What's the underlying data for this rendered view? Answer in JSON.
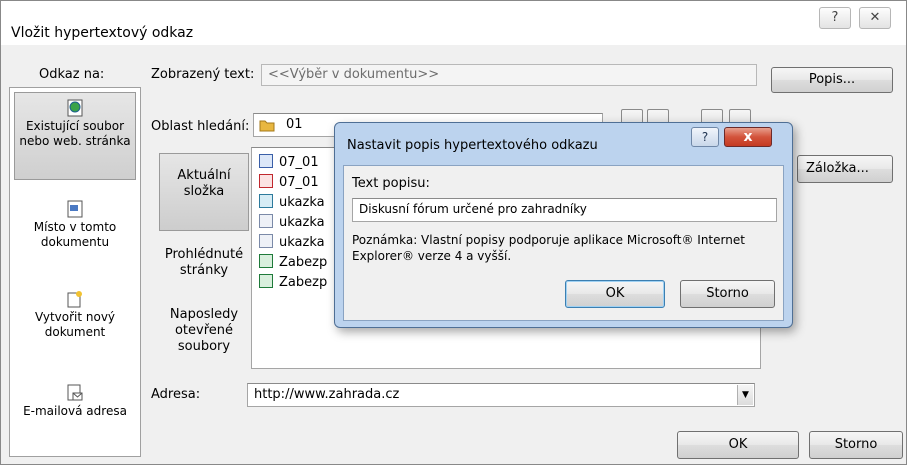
{
  "dialog": {
    "title": "Vložit hypertextový odkaz",
    "help_glyph": "?",
    "close_glyph": "✕"
  },
  "link_to": {
    "label": "Odkaz na:",
    "items": [
      {
        "label": "Existující soubor nebo web. stránka",
        "icon": "globe-file-icon",
        "selected": true
      },
      {
        "label": "Místo v tomto dokumentu",
        "icon": "document-place-icon",
        "selected": false
      },
      {
        "label": "Vytvořit nový dokument",
        "icon": "new-document-icon",
        "selected": false
      },
      {
        "label": "E-mailová adresa",
        "icon": "email-icon",
        "selected": false
      }
    ]
  },
  "display_text": {
    "label": "Zobrazený text:",
    "value": "<<Výběr v dokumentu>>",
    "button": "Popis..."
  },
  "search_in": {
    "label": "Oblast hledání:",
    "value": "01"
  },
  "bookmark_button": "Záložka...",
  "side_tabs": [
    {
      "label": "Aktuální složka",
      "selected": true
    },
    {
      "label": "Prohlédnuté stránky",
      "selected": false
    },
    {
      "label": "Naposledy otevřené soubory",
      "selected": false
    }
  ],
  "files": [
    {
      "name": "07_01",
      "type": "word"
    },
    {
      "name": "07_01",
      "type": "pdf"
    },
    {
      "name": "ukazka",
      "type": "img"
    },
    {
      "name": "ukazka",
      "type": "doc"
    },
    {
      "name": "ukazka",
      "type": "doc"
    },
    {
      "name": "Zabezp",
      "type": "xls"
    },
    {
      "name": "Zabezp",
      "type": "xls"
    }
  ],
  "address": {
    "label": "Adresa:",
    "value": "http://www.zahrada.cz"
  },
  "buttons": {
    "ok": "OK",
    "cancel": "Storno"
  },
  "popup": {
    "title": "Nastavit popis hypertextového odkazu",
    "help_glyph": "?",
    "close_glyph": "x",
    "field_label": "Text popisu:",
    "field_value": "Diskusní fórum určené pro zahradníky",
    "note": "Poznámka: Vlastní popisy podporuje aplikace Microsoft® Internet Explorer® verze 4 a vyšší.",
    "ok": "OK",
    "cancel": "Storno"
  }
}
